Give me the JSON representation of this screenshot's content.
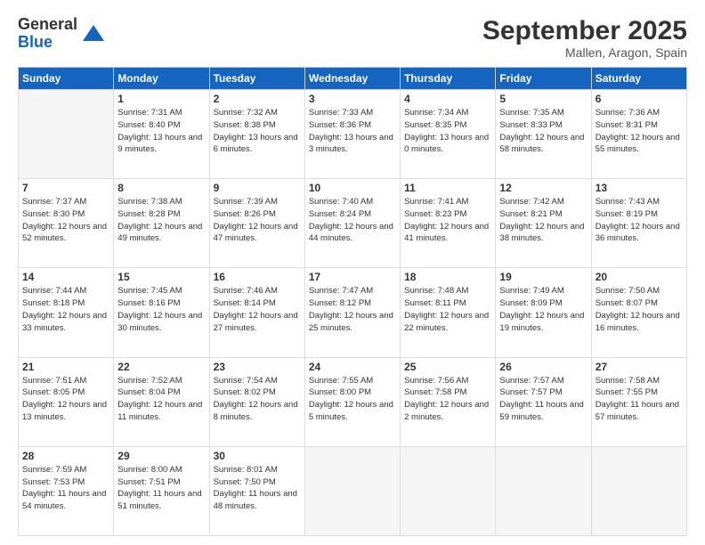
{
  "logo": {
    "general": "General",
    "blue": "Blue"
  },
  "title": "September 2025",
  "location": "Mallen, Aragon, Spain",
  "days_header": [
    "Sunday",
    "Monday",
    "Tuesday",
    "Wednesday",
    "Thursday",
    "Friday",
    "Saturday"
  ],
  "weeks": [
    [
      {
        "num": "",
        "empty": true
      },
      {
        "num": "1",
        "sunrise": "Sunrise: 7:31 AM",
        "sunset": "Sunset: 8:40 PM",
        "daylight": "Daylight: 13 hours and 9 minutes."
      },
      {
        "num": "2",
        "sunrise": "Sunrise: 7:32 AM",
        "sunset": "Sunset: 8:38 PM",
        "daylight": "Daylight: 13 hours and 6 minutes."
      },
      {
        "num": "3",
        "sunrise": "Sunrise: 7:33 AM",
        "sunset": "Sunset: 8:36 PM",
        "daylight": "Daylight: 13 hours and 3 minutes."
      },
      {
        "num": "4",
        "sunrise": "Sunrise: 7:34 AM",
        "sunset": "Sunset: 8:35 PM",
        "daylight": "Daylight: 13 hours and 0 minutes."
      },
      {
        "num": "5",
        "sunrise": "Sunrise: 7:35 AM",
        "sunset": "Sunset: 8:33 PM",
        "daylight": "Daylight: 12 hours and 58 minutes."
      },
      {
        "num": "6",
        "sunrise": "Sunrise: 7:36 AM",
        "sunset": "Sunset: 8:31 PM",
        "daylight": "Daylight: 12 hours and 55 minutes."
      }
    ],
    [
      {
        "num": "7",
        "sunrise": "Sunrise: 7:37 AM",
        "sunset": "Sunset: 8:30 PM",
        "daylight": "Daylight: 12 hours and 52 minutes."
      },
      {
        "num": "8",
        "sunrise": "Sunrise: 7:38 AM",
        "sunset": "Sunset: 8:28 PM",
        "daylight": "Daylight: 12 hours and 49 minutes."
      },
      {
        "num": "9",
        "sunrise": "Sunrise: 7:39 AM",
        "sunset": "Sunset: 8:26 PM",
        "daylight": "Daylight: 12 hours and 47 minutes."
      },
      {
        "num": "10",
        "sunrise": "Sunrise: 7:40 AM",
        "sunset": "Sunset: 8:24 PM",
        "daylight": "Daylight: 12 hours and 44 minutes."
      },
      {
        "num": "11",
        "sunrise": "Sunrise: 7:41 AM",
        "sunset": "Sunset: 8:23 PM",
        "daylight": "Daylight: 12 hours and 41 minutes."
      },
      {
        "num": "12",
        "sunrise": "Sunrise: 7:42 AM",
        "sunset": "Sunset: 8:21 PM",
        "daylight": "Daylight: 12 hours and 38 minutes."
      },
      {
        "num": "13",
        "sunrise": "Sunrise: 7:43 AM",
        "sunset": "Sunset: 8:19 PM",
        "daylight": "Daylight: 12 hours and 36 minutes."
      }
    ],
    [
      {
        "num": "14",
        "sunrise": "Sunrise: 7:44 AM",
        "sunset": "Sunset: 8:18 PM",
        "daylight": "Daylight: 12 hours and 33 minutes."
      },
      {
        "num": "15",
        "sunrise": "Sunrise: 7:45 AM",
        "sunset": "Sunset: 8:16 PM",
        "daylight": "Daylight: 12 hours and 30 minutes."
      },
      {
        "num": "16",
        "sunrise": "Sunrise: 7:46 AM",
        "sunset": "Sunset: 8:14 PM",
        "daylight": "Daylight: 12 hours and 27 minutes."
      },
      {
        "num": "17",
        "sunrise": "Sunrise: 7:47 AM",
        "sunset": "Sunset: 8:12 PM",
        "daylight": "Daylight: 12 hours and 25 minutes."
      },
      {
        "num": "18",
        "sunrise": "Sunrise: 7:48 AM",
        "sunset": "Sunset: 8:11 PM",
        "daylight": "Daylight: 12 hours and 22 minutes."
      },
      {
        "num": "19",
        "sunrise": "Sunrise: 7:49 AM",
        "sunset": "Sunset: 8:09 PM",
        "daylight": "Daylight: 12 hours and 19 minutes."
      },
      {
        "num": "20",
        "sunrise": "Sunrise: 7:50 AM",
        "sunset": "Sunset: 8:07 PM",
        "daylight": "Daylight: 12 hours and 16 minutes."
      }
    ],
    [
      {
        "num": "21",
        "sunrise": "Sunrise: 7:51 AM",
        "sunset": "Sunset: 8:05 PM",
        "daylight": "Daylight: 12 hours and 13 minutes."
      },
      {
        "num": "22",
        "sunrise": "Sunrise: 7:52 AM",
        "sunset": "Sunset: 8:04 PM",
        "daylight": "Daylight: 12 hours and 11 minutes."
      },
      {
        "num": "23",
        "sunrise": "Sunrise: 7:54 AM",
        "sunset": "Sunset: 8:02 PM",
        "daylight": "Daylight: 12 hours and 8 minutes."
      },
      {
        "num": "24",
        "sunrise": "Sunrise: 7:55 AM",
        "sunset": "Sunset: 8:00 PM",
        "daylight": "Daylight: 12 hours and 5 minutes."
      },
      {
        "num": "25",
        "sunrise": "Sunrise: 7:56 AM",
        "sunset": "Sunset: 7:58 PM",
        "daylight": "Daylight: 12 hours and 2 minutes."
      },
      {
        "num": "26",
        "sunrise": "Sunrise: 7:57 AM",
        "sunset": "Sunset: 7:57 PM",
        "daylight": "Daylight: 11 hours and 59 minutes."
      },
      {
        "num": "27",
        "sunrise": "Sunrise: 7:58 AM",
        "sunset": "Sunset: 7:55 PM",
        "daylight": "Daylight: 11 hours and 57 minutes."
      }
    ],
    [
      {
        "num": "28",
        "sunrise": "Sunrise: 7:59 AM",
        "sunset": "Sunset: 7:53 PM",
        "daylight": "Daylight: 11 hours and 54 minutes."
      },
      {
        "num": "29",
        "sunrise": "Sunrise: 8:00 AM",
        "sunset": "Sunset: 7:51 PM",
        "daylight": "Daylight: 11 hours and 51 minutes."
      },
      {
        "num": "30",
        "sunrise": "Sunrise: 8:01 AM",
        "sunset": "Sunset: 7:50 PM",
        "daylight": "Daylight: 11 hours and 48 minutes."
      },
      {
        "num": "",
        "empty": true
      },
      {
        "num": "",
        "empty": true
      },
      {
        "num": "",
        "empty": true
      },
      {
        "num": "",
        "empty": true
      }
    ]
  ]
}
